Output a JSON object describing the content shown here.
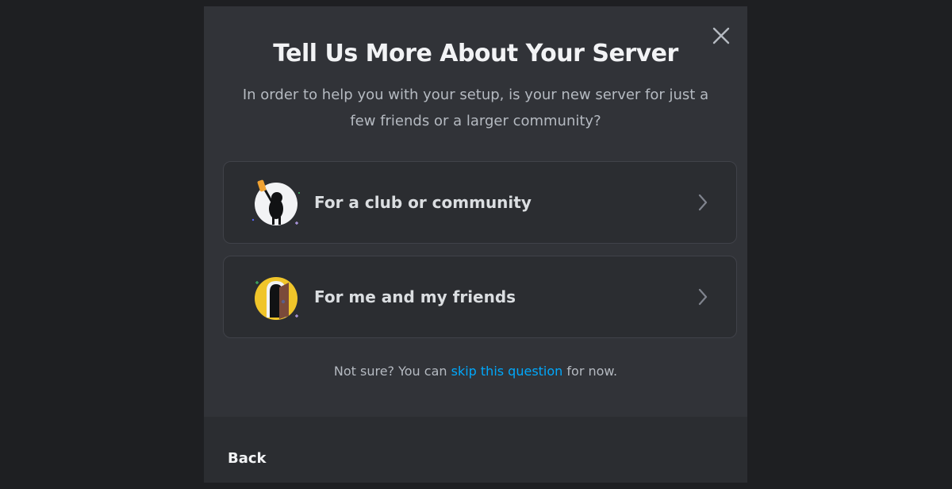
{
  "modal": {
    "title": "Tell Us More About Your Server",
    "subtitle": "In order to help you with your setup, is your new server for just a few friends or a larger community?",
    "close_icon": "close-icon"
  },
  "options": [
    {
      "label": "For a club or community",
      "icon": "club-community-illustration"
    },
    {
      "label": "For me and my friends",
      "icon": "friends-illustration"
    }
  ],
  "skip": {
    "prefix": "Not sure? You can ",
    "link": "skip this question",
    "suffix": " for now."
  },
  "footer": {
    "back_label": "Back"
  },
  "colors": {
    "modal_bg": "#313338",
    "footer_bg": "#2b2d31",
    "link": "#00a8fc",
    "text_muted": "#b5bac1",
    "text_primary": "#f2f3f5"
  }
}
